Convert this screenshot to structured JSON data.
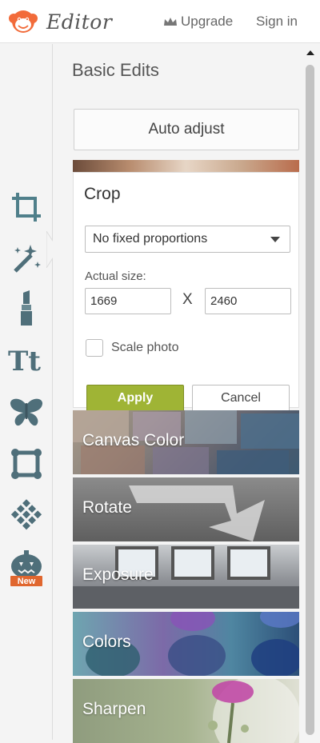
{
  "header": {
    "app_title": "Editor",
    "upgrade_label": "Upgrade",
    "signin_label": "Sign in"
  },
  "toolbar": {
    "tools": [
      {
        "icon": "crop-icon"
      },
      {
        "icon": "magic-wand-icon"
      },
      {
        "icon": "lipstick-icon"
      },
      {
        "icon": "text-icon",
        "label": "Tt"
      },
      {
        "icon": "butterfly-icon"
      },
      {
        "icon": "frame-icon"
      },
      {
        "icon": "texture-icon"
      },
      {
        "icon": "pumpkin-icon",
        "badge": "New"
      }
    ]
  },
  "panel": {
    "title": "Basic Edits",
    "auto_adjust_label": "Auto adjust",
    "crop": {
      "title": "Crop",
      "proportion": "No fixed proportions",
      "size_label": "Actual size:",
      "width": "1669",
      "separator": "X",
      "height": "2460",
      "scale_label": "Scale photo",
      "apply_label": "Apply",
      "cancel_label": "Cancel"
    },
    "sections": [
      {
        "label": "Canvas Color"
      },
      {
        "label": "Rotate"
      },
      {
        "label": "Exposure"
      },
      {
        "label": "Colors"
      },
      {
        "label": "Sharpen"
      }
    ]
  },
  "colors": {
    "accent_green": "#9fb435",
    "brand_orange": "#f26b3a",
    "tool_icon": "#4f6f7a"
  }
}
